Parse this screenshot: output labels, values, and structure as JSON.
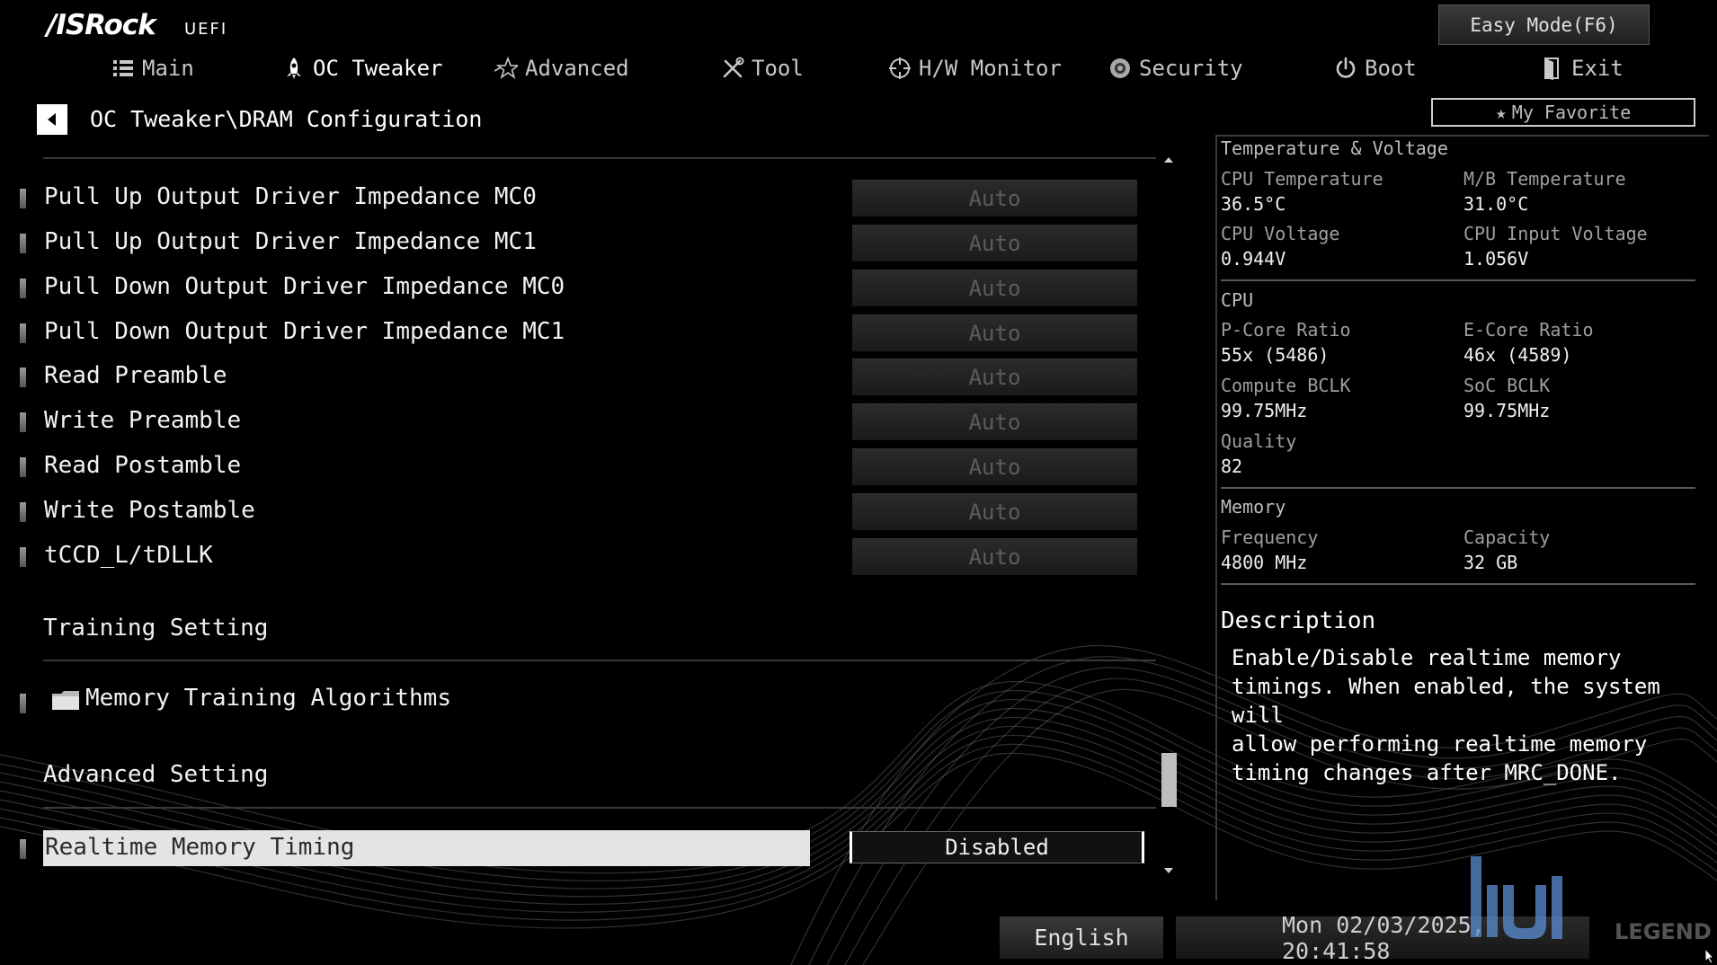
{
  "header": {
    "logo": "/ISRock",
    "logo_sub": "UEFI",
    "easy_mode_label": "Easy Mode(F6)"
  },
  "tabs": [
    {
      "label": "Main",
      "icon": "list-icon"
    },
    {
      "label": "OC Tweaker",
      "icon": "rocket-icon",
      "active": true
    },
    {
      "label": "Advanced",
      "icon": "star-icon"
    },
    {
      "label": "Tool",
      "icon": "wrench-icon"
    },
    {
      "label": "H/W Monitor",
      "icon": "crosshair-icon"
    },
    {
      "label": "Security",
      "icon": "shield-icon"
    },
    {
      "label": "Boot",
      "icon": "power-icon"
    },
    {
      "label": "Exit",
      "icon": "exit-icon"
    }
  ],
  "breadcrumb": "OC Tweaker\\DRAM Configuration",
  "favorite_label": "My Favorite",
  "settings": [
    {
      "label": "Pull Up Output Driver Impedance MC0",
      "value": "Auto"
    },
    {
      "label": "Pull Up Output Driver Impedance MC1",
      "value": "Auto"
    },
    {
      "label": "Pull Down Output Driver Impedance MC0",
      "value": "Auto"
    },
    {
      "label": "Pull Down Output Driver Impedance MC1",
      "value": "Auto"
    },
    {
      "label": "Read Preamble",
      "value": "Auto"
    },
    {
      "label": "Write Preamble",
      "value": "Auto"
    },
    {
      "label": "Read Postamble",
      "value": "Auto"
    },
    {
      "label": "Write Postamble",
      "value": "Auto"
    },
    {
      "label": "tCCD_L/tDLLK",
      "value": "Auto"
    }
  ],
  "training_section": "Training Setting",
  "folder_item": "Memory Training Algorithms",
  "advanced_section": "Advanced Setting",
  "selected_setting": {
    "label": "Realtime Memory Timing",
    "value": "Disabled"
  },
  "panel": {
    "temp_volt_title": "Temperature & Voltage",
    "cpu_temp_label": "CPU Temperature",
    "cpu_temp": "36.5°C",
    "mb_temp_label": "M/B Temperature",
    "mb_temp": "31.0°C",
    "cpu_volt_label": "CPU Voltage",
    "cpu_volt": "0.944V",
    "cpu_in_volt_label": "CPU Input Voltage",
    "cpu_in_volt": "1.056V",
    "cpu_title": "CPU",
    "pcore_label": "P-Core Ratio",
    "pcore": "55x (5486)",
    "ecore_label": "E-Core Ratio",
    "ecore": "46x (4589)",
    "compute_bclk_label": "Compute BCLK",
    "compute_bclk": "99.75MHz",
    "soc_bclk_label": "SoC BCLK",
    "soc_bclk": "99.75MHz",
    "quality_label": "Quality",
    "quality": "82",
    "memory_title": "Memory",
    "freq_label": "Frequency",
    "freq": "4800 MHz",
    "cap_label": "Capacity",
    "cap": "32 GB"
  },
  "description": {
    "title": "Description",
    "text": "Enable/Disable realtime memory\ntimings. When enabled, the system will\nallow performing realtime memory\ntiming changes after MRC_DONE."
  },
  "footer": {
    "language": "English",
    "datetime": "Mon 02/03/2025, 20:41:58"
  },
  "watermark_text": "LEGEND"
}
